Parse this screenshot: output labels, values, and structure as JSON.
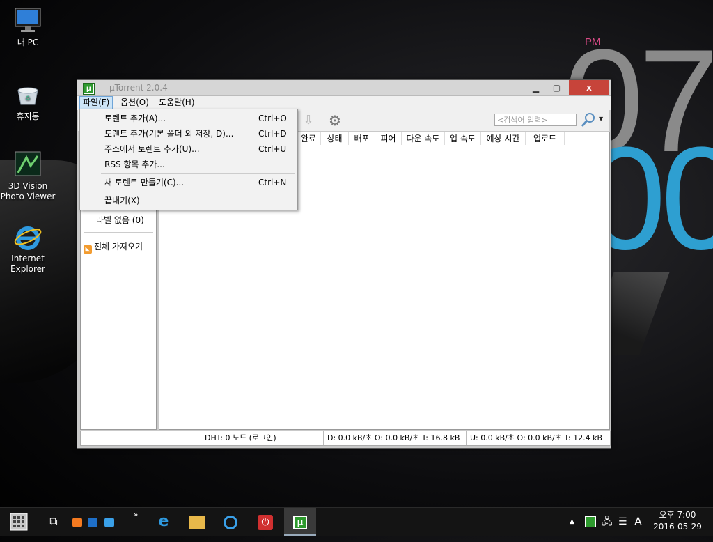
{
  "desktop": {
    "icons": [
      {
        "label": "내 PC",
        "icon": "monitor-icon"
      },
      {
        "label": "휴지통",
        "icon": "recycle-bin-icon"
      },
      {
        "label": "3D Vision\nPhoto Viewer",
        "icon": "3d-vision-icon"
      },
      {
        "label": "Internet\nExplorer",
        "icon": "ie-icon"
      }
    ],
    "clock_widget": {
      "ampm": "PM",
      "hour": "07",
      "minute": "00"
    }
  },
  "window": {
    "title": "µTorrent 2.0.4",
    "controls": {
      "minimize": "▁",
      "maximize": "▢",
      "close": "x"
    },
    "menu": {
      "file": "파일(F)",
      "options": "옵션(O)",
      "help": "도움말(H)"
    },
    "search_placeholder": "<검색어 입력>",
    "sidebar": {
      "no_label": "라벨 없음 (0)",
      "rss_all": "전체 가져오기"
    },
    "columns": [
      "완료",
      "상태",
      "배포",
      "피어",
      "다운 속도",
      "업 속도",
      "예상 시간",
      "업로드"
    ],
    "status": {
      "dht": "DHT: 0 노드  (로그인)",
      "download": "D: 0.0 kB/초 O: 0.0 kB/초 T: 16.8 kB",
      "upload": "U: 0.0 kB/초 O: 0.0 kB/초 T: 12.4 kB"
    }
  },
  "file_menu": {
    "items": [
      {
        "label": "토렌트 추가(A)...",
        "shortcut": "Ctrl+O"
      },
      {
        "label": "토렌트 추가(기본 폴더 외 저장, D)...",
        "shortcut": "Ctrl+D"
      },
      {
        "label": "주소에서 토렌트 추가(U)...",
        "shortcut": "Ctrl+U"
      },
      {
        "label": "RSS 항목 추가...",
        "shortcut": ""
      },
      {
        "label": "새 토렌트 만들기(C)...",
        "shortcut": "Ctrl+N"
      },
      {
        "label": "끝내기(X)",
        "shortcut": ""
      }
    ]
  },
  "taskbar": {
    "ime": "A",
    "clock_time": "오후 7:00",
    "clock_date": "2016-05-29"
  }
}
